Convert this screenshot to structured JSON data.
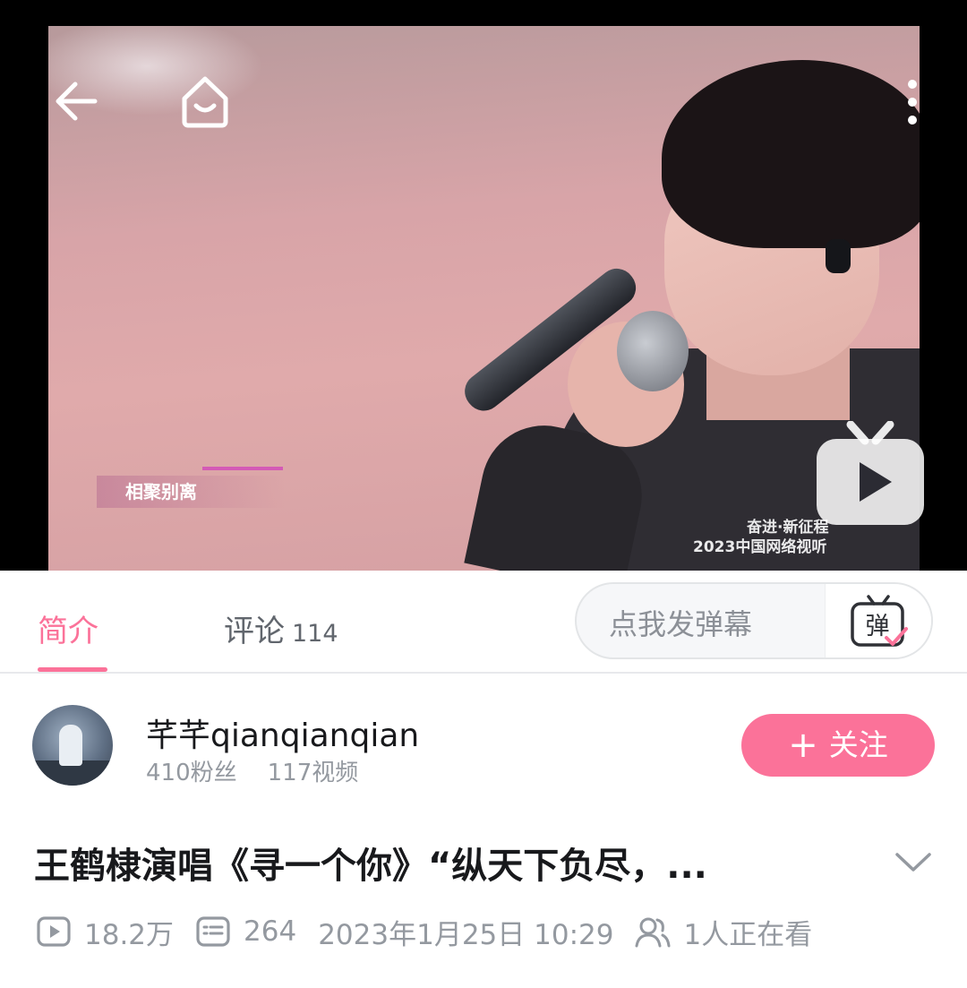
{
  "player": {
    "overlay_text": "相聚别离",
    "stage_logo_line1": "奋进·新征程",
    "stage_logo_line2": "2023中国网络视听",
    "icons": [
      "back-arrow-icon",
      "home-icon",
      "more-vertical-icon",
      "bilibili-tv-play-icon"
    ]
  },
  "tabs": {
    "intro_label": "简介",
    "comments_label": "评论",
    "comments_count": "114",
    "active": "intro"
  },
  "danmaku": {
    "placeholder": "点我发弹幕",
    "toggle_label": "弹"
  },
  "uploader": {
    "name": "芊芊qianqianqian",
    "fans": "410粉丝",
    "videos": "117视频",
    "follow_label": "关注"
  },
  "video": {
    "title": "王鹤棣演唱《寻一个你》“纵天下负尽，...",
    "views": "18.2万",
    "danmaku_count": "264",
    "date": "2023年1月25日 10:29",
    "watching": "1人正在看"
  },
  "colors": {
    "accent": "#fb7299",
    "muted_text": "#9499a0",
    "tab_inactive": "#61666d"
  }
}
